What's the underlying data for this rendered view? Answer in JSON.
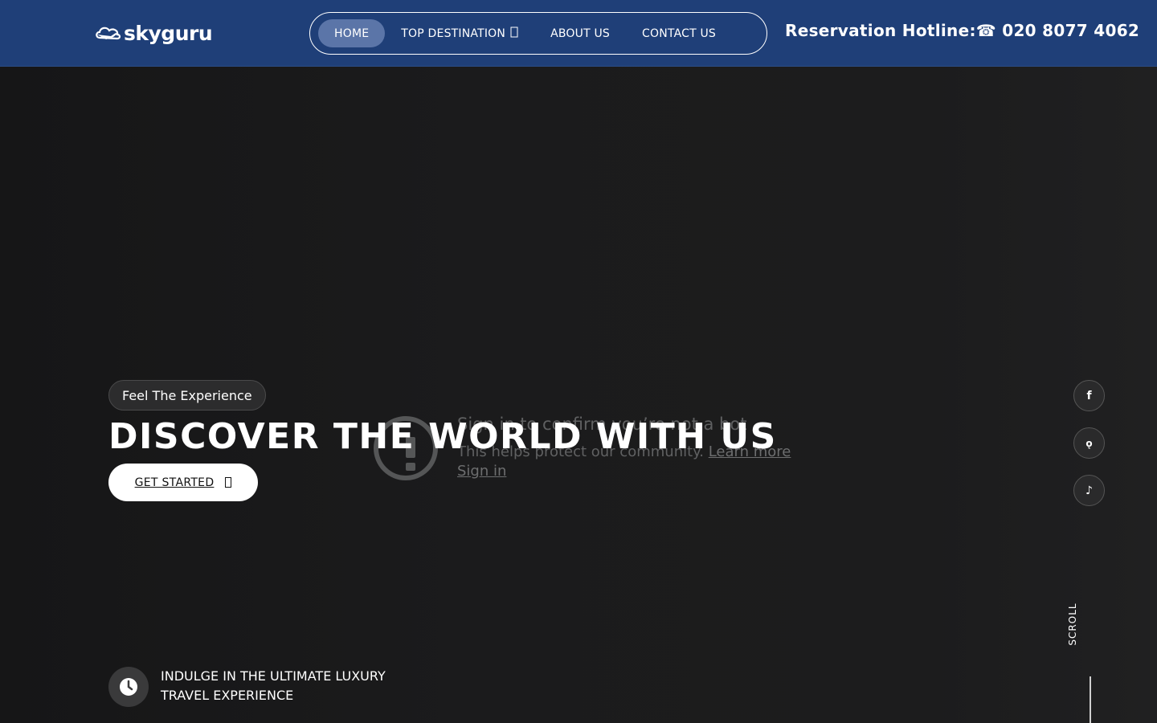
{
  "header": {
    "logo_text": "skyguru",
    "nav": [
      {
        "label": "HOME",
        "active": true
      },
      {
        "label": "TOP DESTINATION",
        "has_dropdown": true
      },
      {
        "label": "ABOUT US"
      },
      {
        "label": "CONTACT US"
      }
    ],
    "hotline_label": "Reservation Hotline:",
    "hotline_icon": "☎",
    "hotline_number": "020 8077 4062"
  },
  "hero": {
    "badge": "Feel The Experience",
    "title": "DISCOVER THE WORLD WITH US",
    "cta_label": "GET STARTED",
    "notice": {
      "title": "Sign in to confirm you’re not a bot",
      "subtitle": "This helps protect our community.",
      "learn_more": "Learn more",
      "sign_in": "Sign in"
    },
    "social": [
      {
        "icon": "facebook-icon",
        "glyph": "f"
      },
      {
        "icon": "snapchat-icon",
        "glyph": "ǫ"
      },
      {
        "icon": "tiktok-icon",
        "glyph": "♪"
      }
    ],
    "scroll_label": "SCROLL",
    "feature_line1": "INDULGE IN THE ULTIMATE LUXURY",
    "feature_line2": "TRAVEL EXPERIENCE"
  },
  "colors": {
    "header_bg": "#1f3f78",
    "nav_active_bg": "#5b75a8",
    "hero_bg": "#1a1a1b"
  }
}
